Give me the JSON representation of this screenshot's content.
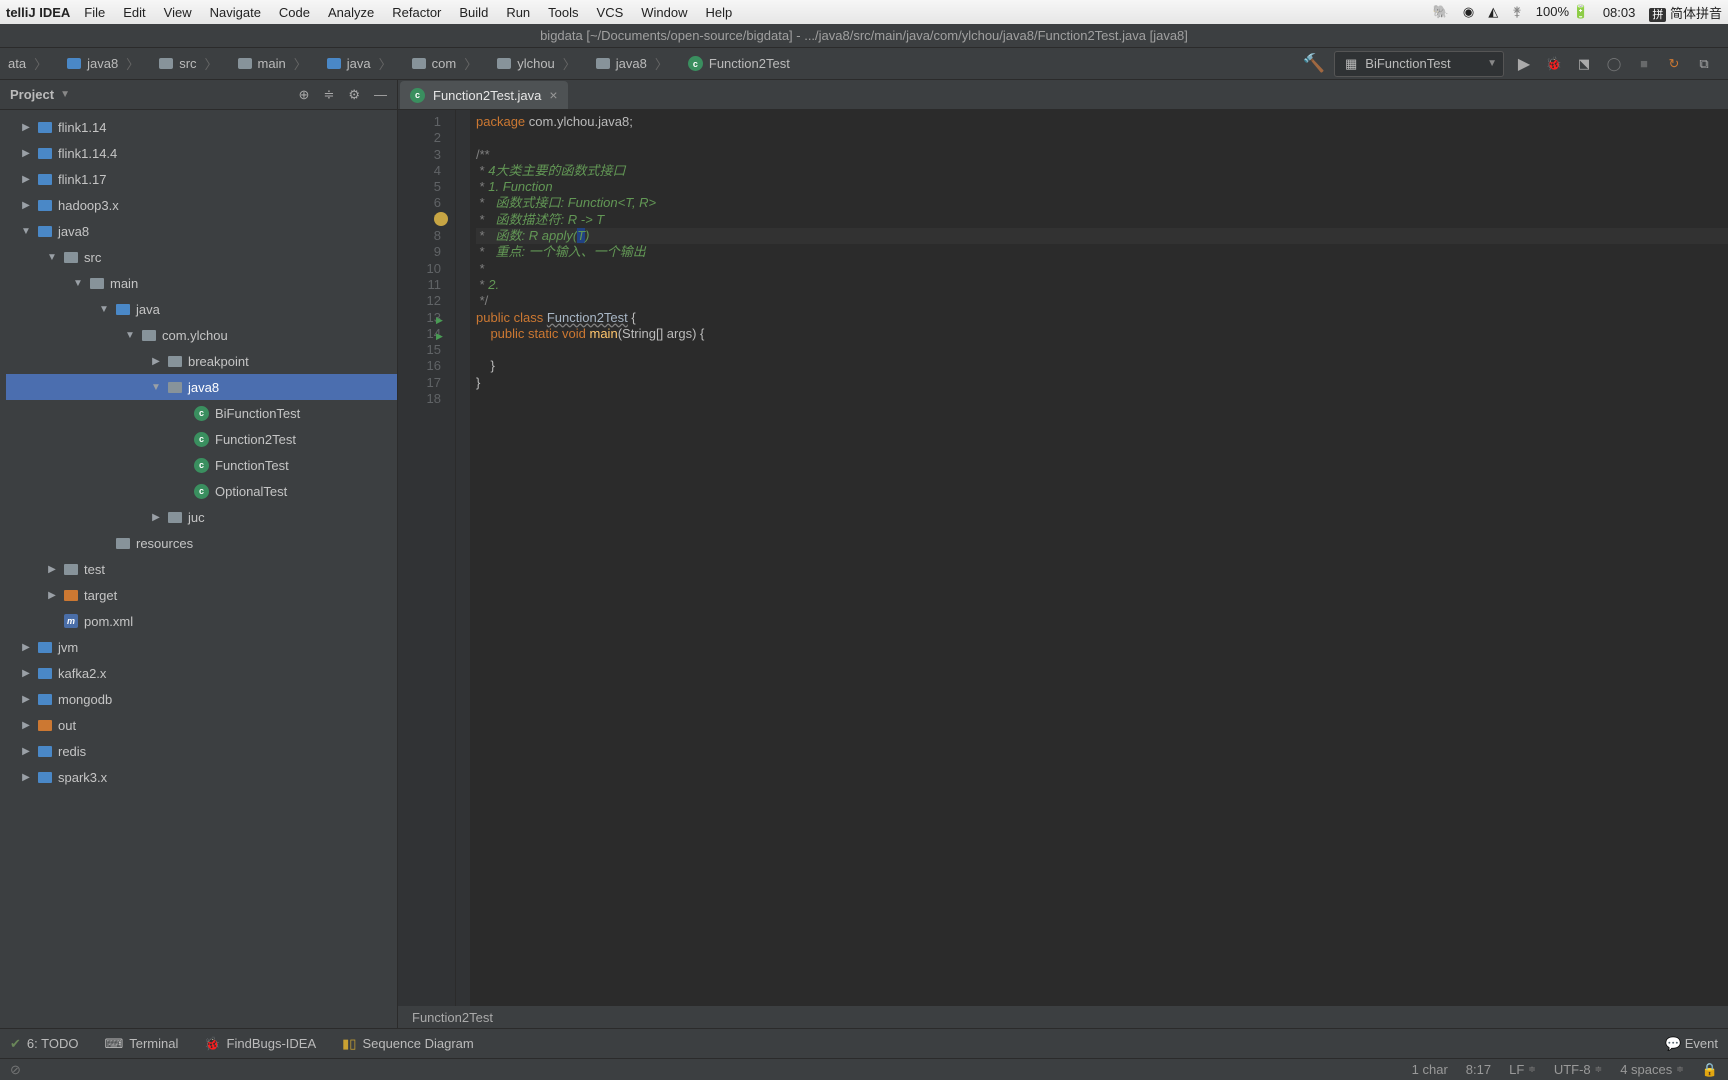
{
  "menubar": {
    "app": "telliJ IDEA",
    "items": [
      "File",
      "Edit",
      "View",
      "Navigate",
      "Code",
      "Analyze",
      "Refactor",
      "Build",
      "Run",
      "Tools",
      "VCS",
      "Window",
      "Help"
    ],
    "battery": "100%",
    "clock": "08:03",
    "ime": "简体拼音",
    "ime_marker": "拼"
  },
  "window_title": "bigdata [~/Documents/open-source/bigdata] - .../java8/src/main/java/com/ylchou/java8/Function2Test.java [java8]",
  "crumbs": [
    "ata",
    "java8",
    "src",
    "main",
    "java",
    "com",
    "ylchou",
    "java8",
    "Function2Test"
  ],
  "run_config": "BiFunctionTest",
  "project_label": "Project",
  "tree": {
    "root_hint": "bigdata   ~/Documents/open-source/bigdata",
    "items": [
      {
        "d": 1,
        "type": "module",
        "open": true,
        "label": "flink1.14"
      },
      {
        "d": 1,
        "type": "module",
        "open": true,
        "label": "flink1.14.4"
      },
      {
        "d": 1,
        "type": "module",
        "open": true,
        "label": "flink1.17"
      },
      {
        "d": 1,
        "type": "module",
        "open": true,
        "label": "hadoop3.x"
      },
      {
        "d": 1,
        "type": "module",
        "open": true,
        "label": "java8",
        "expanded": true
      },
      {
        "d": 2,
        "type": "folder",
        "open": true,
        "label": "src",
        "expanded": true
      },
      {
        "d": 3,
        "type": "folder",
        "open": true,
        "label": "main",
        "expanded": true
      },
      {
        "d": 4,
        "type": "folder-b",
        "open": true,
        "label": "java",
        "expanded": true
      },
      {
        "d": 5,
        "type": "folder",
        "open": true,
        "label": "com.ylchou",
        "expanded": true
      },
      {
        "d": 6,
        "type": "folder",
        "open": false,
        "label": "breakpoint"
      },
      {
        "d": 6,
        "type": "folder",
        "open": true,
        "label": "java8",
        "expanded": true,
        "selected": true
      },
      {
        "d": 7,
        "type": "class",
        "label": "BiFunctionTest"
      },
      {
        "d": 7,
        "type": "class",
        "label": "Function2Test"
      },
      {
        "d": 7,
        "type": "class",
        "label": "FunctionTest"
      },
      {
        "d": 7,
        "type": "class",
        "label": "OptionalTest"
      },
      {
        "d": 6,
        "type": "folder",
        "open": false,
        "label": "juc"
      },
      {
        "d": 4,
        "type": "res",
        "label": "resources"
      },
      {
        "d": 2,
        "type": "folder",
        "open": false,
        "label": "test"
      },
      {
        "d": 2,
        "type": "target",
        "open": false,
        "label": "target"
      },
      {
        "d": 2,
        "type": "pom",
        "label": "pom.xml"
      },
      {
        "d": 1,
        "type": "module",
        "open": true,
        "label": "jvm"
      },
      {
        "d": 1,
        "type": "module",
        "open": true,
        "label": "kafka2.x"
      },
      {
        "d": 1,
        "type": "module",
        "open": true,
        "label": "mongodb"
      },
      {
        "d": 1,
        "type": "target",
        "open": true,
        "label": "out"
      },
      {
        "d": 1,
        "type": "module",
        "open": true,
        "label": "redis"
      },
      {
        "d": 1,
        "type": "module",
        "open": true,
        "label": "spark3.x"
      }
    ]
  },
  "tab": {
    "label": "Function2Test.java"
  },
  "code": {
    "lines": 18,
    "content": [
      {
        "n": 1,
        "html": "<span class='k'>package</span> com.ylchou.java8;"
      },
      {
        "n": 2,
        "html": ""
      },
      {
        "n": 3,
        "html": "<span class='com'>/**</span>"
      },
      {
        "n": 4,
        "html": "<span class='com'> * </span><span class='comg'>4大类主要的函数式接口</span>"
      },
      {
        "n": 5,
        "html": "<span class='com'> * </span><span class='comg'>1. Function</span>"
      },
      {
        "n": 6,
        "html": "<span class='com'> *   </span><span class='comg'>函数式接口: Function&lt;T, R&gt;</span>"
      },
      {
        "n": 7,
        "html": "<span class='com'> *   </span><span class='comg'>函数描述符: R -&gt; T</span>",
        "bulb": true
      },
      {
        "n": 8,
        "html": "<span class='com'> *   </span><span class='comg'>函数: R apply(</span><span class='comg hl'>T</span><span class='comg'>)</span>",
        "caret": true
      },
      {
        "n": 9,
        "html": "<span class='com'> *   </span><span class='comg'>重点: 一个输入、一个输出</span>"
      },
      {
        "n": 10,
        "html": "<span class='com'> *</span>"
      },
      {
        "n": 11,
        "html": "<span class='com'> * </span><span class='comg'>2.</span>"
      },
      {
        "n": 12,
        "html": "<span class='com'> */</span>"
      },
      {
        "n": 13,
        "html": "<span class='k'>public</span> <span class='k'>class</span> <span class='cls'>Function2Test</span> {",
        "run": true
      },
      {
        "n": 14,
        "html": "    <span class='k'>public</span> <span class='k'>static</span> <span class='k'>void</span> <span class='fn'>main</span>(String[] args) {",
        "run": true
      },
      {
        "n": 15,
        "html": ""
      },
      {
        "n": 16,
        "html": "    }"
      },
      {
        "n": 17,
        "html": "}"
      },
      {
        "n": 18,
        "html": ""
      }
    ]
  },
  "breadcrumb_editor": "Function2Test",
  "bottom": {
    "items": [
      "6: TODO",
      "Terminal",
      "FindBugs-IDEA",
      "Sequence Diagram"
    ],
    "event": "Event"
  },
  "status": {
    "sel": "1 char",
    "pos": "8:17",
    "le": "LF",
    "enc": "UTF-8",
    "indent": "4 spaces"
  }
}
